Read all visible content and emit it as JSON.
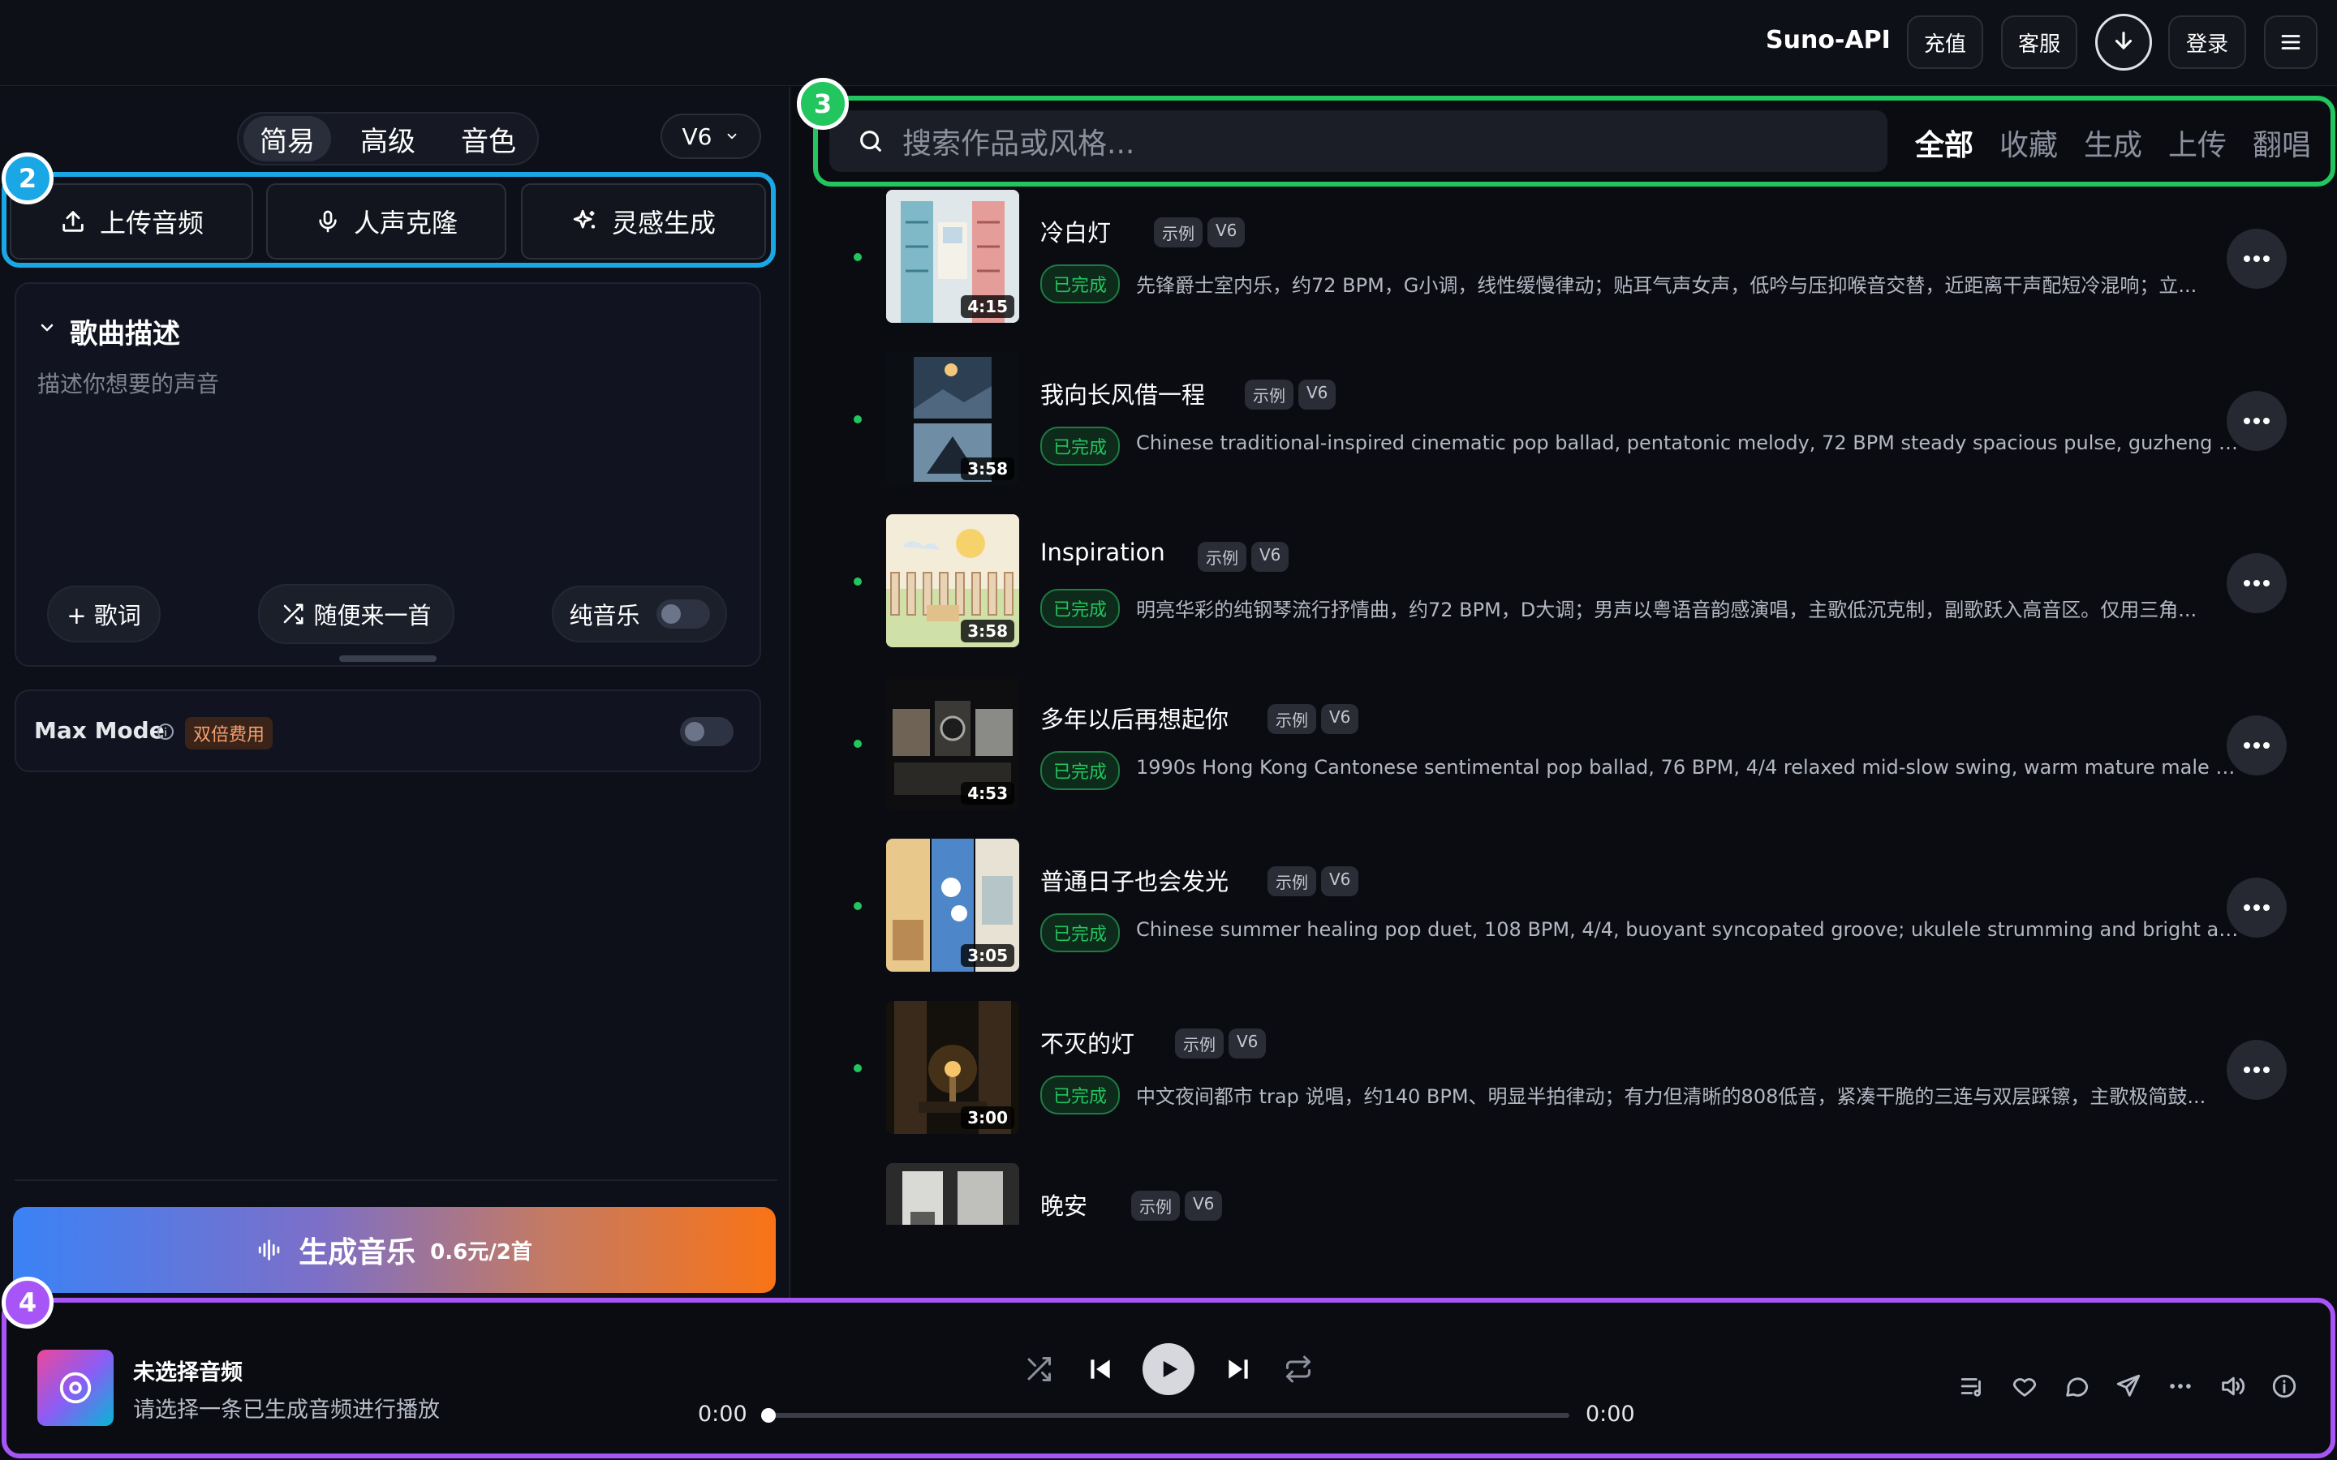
{
  "header": {
    "brand": "Suno-API",
    "recharge_label": "充值",
    "support_label": "客服",
    "login_label": "登录"
  },
  "left": {
    "mode_tabs": [
      "简易",
      "高级",
      "音色"
    ],
    "active_mode": "简易",
    "version": "V6",
    "actions": {
      "upload": "上传音频",
      "voice_clone": "人声克隆",
      "inspiration": "灵感生成"
    },
    "description": {
      "title": "歌曲描述",
      "placeholder": "描述你想要的声音",
      "lyrics_btn": "+ 歌词",
      "random_btn": "随便来一首",
      "instrumental_label": "纯音乐"
    },
    "max_mode": {
      "label": "Max Mode",
      "badge": "双倍费用"
    },
    "generate": {
      "label": "生成音乐",
      "price": "0.6元/2首"
    }
  },
  "right": {
    "search_placeholder": "搜索作品或风格...",
    "filters": [
      "全部",
      "收藏",
      "生成",
      "上传",
      "翻唱"
    ],
    "active_filter": "全部",
    "songs": [
      {
        "title": "冷白灯",
        "tag1": "示例",
        "tag2": "V6",
        "status": "已完成",
        "duration": "4:15",
        "desc": "先锋爵士室内乐，约72 BPM，G小调，线性缓慢律动；贴耳气声女声，低吟与压抑喉音交替，近距离干声配短冷混响；立..."
      },
      {
        "title": "我向长风借一程",
        "tag1": "示例",
        "tag2": "V6",
        "status": "已完成",
        "duration": "3:58",
        "desc": "Chinese traditional-inspired cinematic pop ballad, pentatonic melody, 72 BPM steady spacious pulse, guzheng and ba..."
      },
      {
        "title": "Inspiration",
        "tag1": "示例",
        "tag2": "V6",
        "status": "已完成",
        "duration": "3:58",
        "desc": "明亮华彩的纯钢琴流行抒情曲，约72 BPM，D大调；男声以粤语音韵感演唱，主歌低沉克制，副歌跃入高音区。仅用三角..."
      },
      {
        "title": "多年以后再想起你",
        "tag1": "示例",
        "tag2": "V6",
        "status": "已完成",
        "duration": "4:53",
        "desc": "1990s Hong Kong Cantonese sentimental pop ballad, 76 BPM, 4/4 relaxed mid-slow swing, warm mature male Canto..."
      },
      {
        "title": "普通日子也会发光",
        "tag1": "示例",
        "tag2": "V6",
        "status": "已完成",
        "duration": "3:05",
        "desc": "Chinese summer healing pop duet, 108 BPM, 4/4, buoyant syncopated groove; ukulele strumming and bright acoustic..."
      },
      {
        "title": "不灭的灯",
        "tag1": "示例",
        "tag2": "V6",
        "status": "已完成",
        "duration": "3:00",
        "desc": "中文夜间都市 trap 说唱，约140 BPM、明显半拍律动；有力但清晰的808低音，紧凑干脆的三连与双层踩镲，主歌极简鼓..."
      },
      {
        "title": "晚安",
        "tag1": "示例",
        "tag2": "V6"
      }
    ]
  },
  "player": {
    "title": "未选择音频",
    "subtitle": "请选择一条已生成音频进行播放",
    "time_current": "0:00",
    "time_total": "0:00",
    "progress": 0
  },
  "badges": {
    "b2": "2",
    "b3": "3",
    "b4": "4"
  },
  "colors": {
    "accent_blue": "#1aa7e6",
    "accent_green": "#22c55e",
    "accent_purple": "#a855f7",
    "status_green": "#22c55e",
    "max_mode_badge": "#f59e6b"
  }
}
